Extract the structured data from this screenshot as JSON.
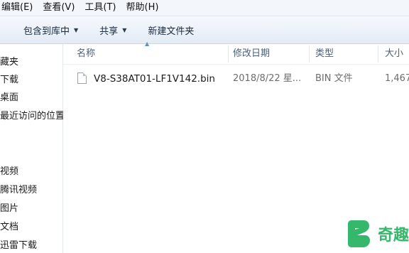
{
  "menubar": {
    "items": [
      {
        "label": "编辑(E)"
      },
      {
        "label": "查看(V)"
      },
      {
        "label": "工具(T)"
      },
      {
        "label": "帮助(H)"
      }
    ]
  },
  "toolbar": {
    "include_library": "包含到库中",
    "share": "共享",
    "new_folder": "新建文件夹"
  },
  "nav": {
    "items": [
      {
        "label": "藏夹"
      },
      {
        "label": "下载"
      },
      {
        "label": "桌面"
      },
      {
        "label": "最近访问的位置"
      },
      {
        "label": "视频"
      },
      {
        "label": "腾讯视频"
      },
      {
        "label": "图片"
      },
      {
        "label": "文档"
      },
      {
        "label": "迅雷下载"
      }
    ]
  },
  "columns": {
    "name": "名称",
    "date": "修改日期",
    "type": "类型",
    "size": "大小"
  },
  "files": [
    {
      "name": "V8-S38AT01-LF1V142.bin",
      "date": "2018/8/22 星...",
      "type": "BIN 文件",
      "size": "1,467"
    }
  ],
  "watermark": {
    "text": "奇趣",
    "color": "#35b86b"
  }
}
